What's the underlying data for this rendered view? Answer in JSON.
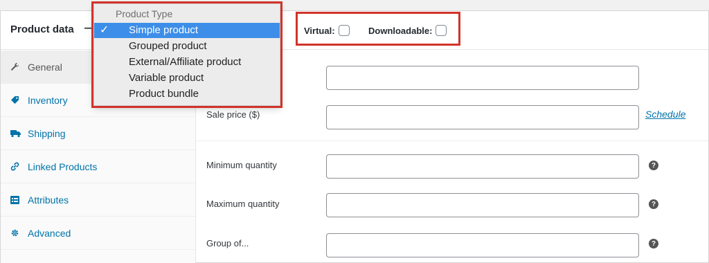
{
  "header": {
    "title": "Product data",
    "dash": "—",
    "virtual_label": "Virtual:",
    "downloadable_label": "Downloadable:"
  },
  "dropdown": {
    "group_label": "Product Type",
    "selected_mark": "✓",
    "options": [
      {
        "label": "Simple product",
        "selected": true
      },
      {
        "label": "Grouped product",
        "selected": false
      },
      {
        "label": "External/Affiliate product",
        "selected": false
      },
      {
        "label": "Variable product",
        "selected": false
      },
      {
        "label": "Product bundle",
        "selected": false
      }
    ]
  },
  "sidebar": {
    "items": [
      {
        "label": "General",
        "icon": "wrench-icon"
      },
      {
        "label": "Inventory",
        "icon": "tag-icon"
      },
      {
        "label": "Shipping",
        "icon": "truck-icon"
      },
      {
        "label": "Linked Products",
        "icon": "link-icon"
      },
      {
        "label": "Attributes",
        "icon": "list-icon"
      },
      {
        "label": "Advanced",
        "icon": "gear-icon"
      }
    ]
  },
  "fields": {
    "regular_price_value": "",
    "sale_price_label": "Sale price ($)",
    "sale_price_value": "",
    "schedule_link": "Schedule",
    "min_qty_label": "Minimum quantity",
    "min_qty_value": "",
    "max_qty_label": "Maximum quantity",
    "max_qty_value": "",
    "group_of_label": "Group of...",
    "group_of_value": "",
    "help_glyph": "?"
  },
  "colors": {
    "highlight_border": "#d1332a",
    "selected_option": "#3d8ee8",
    "link": "#0073aa"
  }
}
